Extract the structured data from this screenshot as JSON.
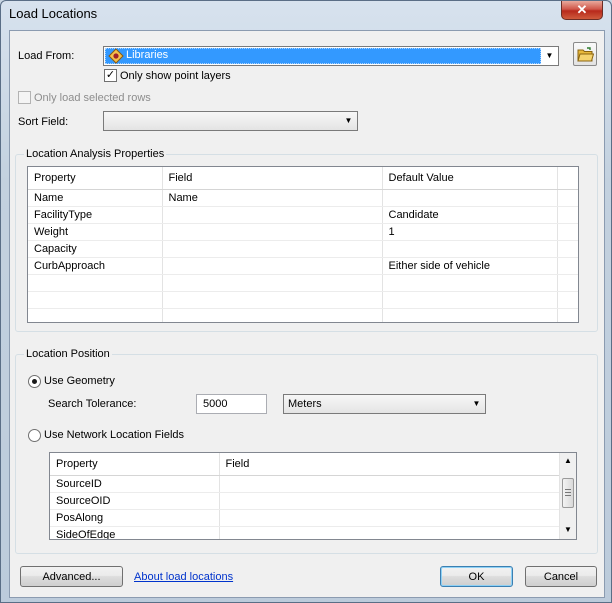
{
  "window": {
    "title": "Load Locations",
    "close_glyph": "✕"
  },
  "load_from": {
    "label": "Load From:",
    "value": "Libraries",
    "icon": "point-layer-icon"
  },
  "only_point_layers": {
    "label": "Only show point layers",
    "checked": true
  },
  "only_selected_rows": {
    "label": "Only load selected rows",
    "checked": false,
    "enabled": false
  },
  "sort_field": {
    "label": "Sort Field:",
    "value": ""
  },
  "location_analysis": {
    "title": "Location Analysis Properties",
    "columns": [
      "Property",
      "Field",
      "Default Value"
    ],
    "rows": [
      {
        "property": "Name",
        "field": "Name",
        "default": ""
      },
      {
        "property": "FacilityType",
        "field": "",
        "default": "Candidate"
      },
      {
        "property": "Weight",
        "field": "",
        "default": "1"
      },
      {
        "property": "Capacity",
        "field": "",
        "default": ""
      },
      {
        "property": "CurbApproach",
        "field": "",
        "default": "Either side of vehicle"
      }
    ]
  },
  "location_position": {
    "title": "Location Position",
    "use_geometry": {
      "label": "Use Geometry",
      "selected": true
    },
    "search_tolerance": {
      "label": "Search Tolerance:",
      "value": "5000",
      "units": "Meters"
    },
    "use_network_fields": {
      "label": "Use Network Location Fields",
      "selected": false
    },
    "network_grid": {
      "columns": [
        "Property",
        "Field"
      ],
      "rows": [
        "SourceID",
        "SourceOID",
        "PosAlong",
        "SideOfEdge"
      ]
    }
  },
  "footer": {
    "advanced": "Advanced...",
    "about_link": "About load locations",
    "ok": "OK",
    "cancel": "Cancel"
  }
}
